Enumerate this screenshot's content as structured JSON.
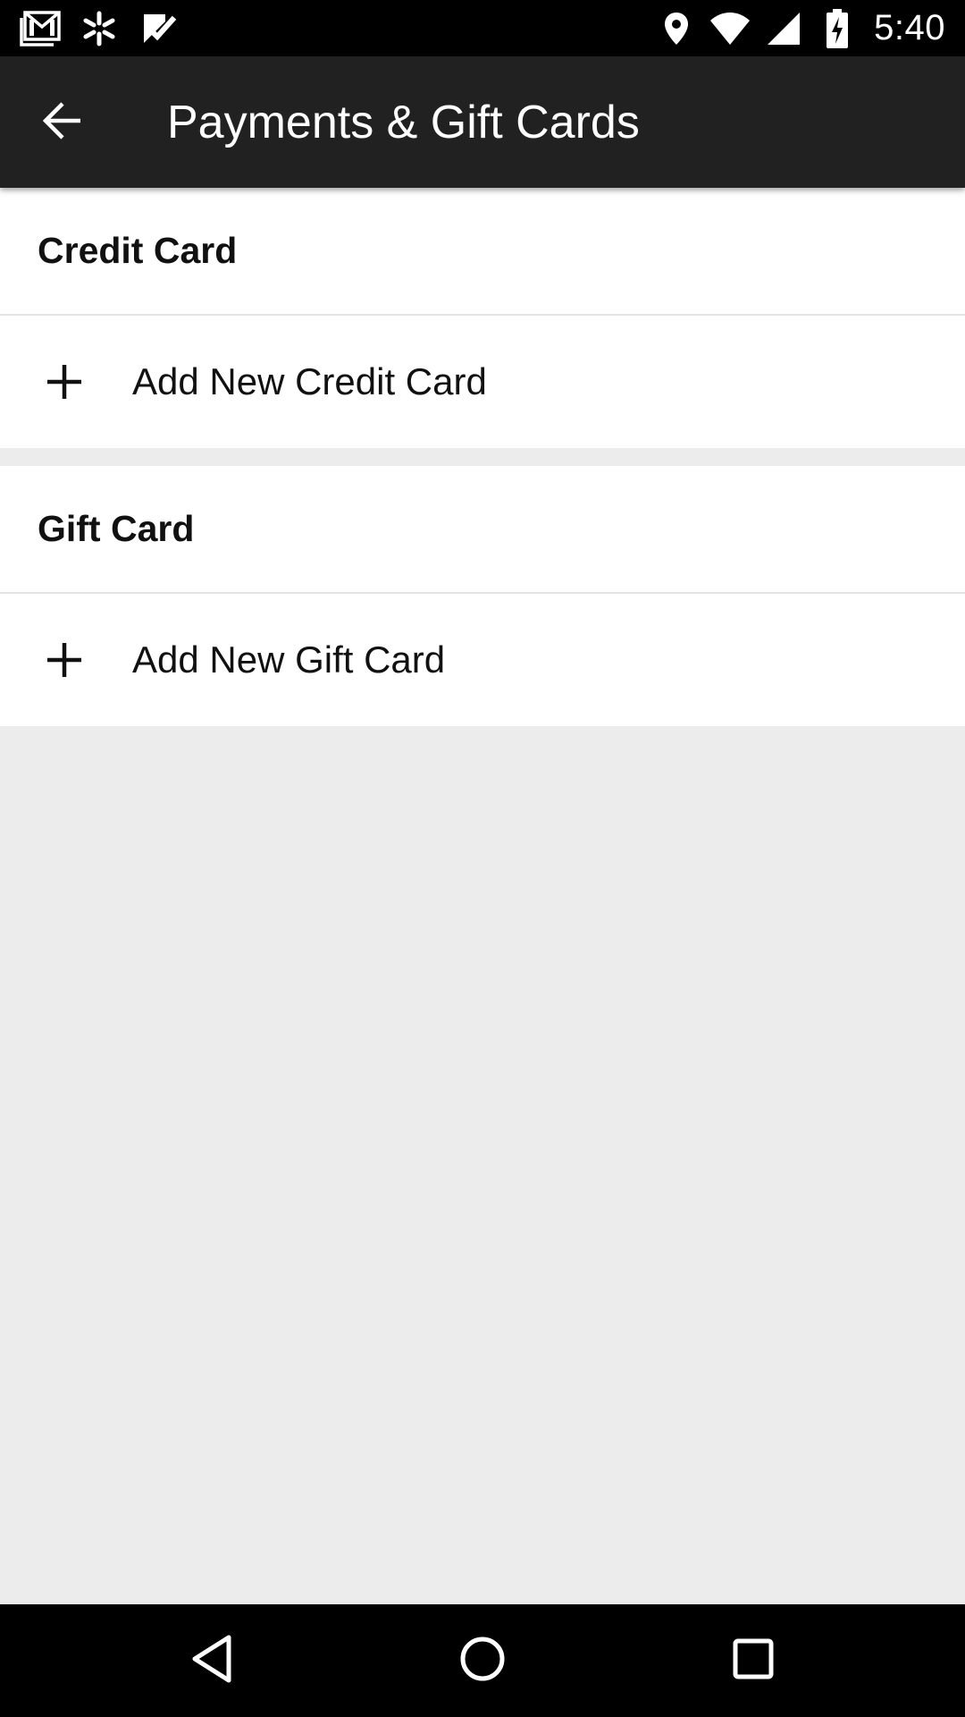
{
  "status_bar": {
    "time": "5:40",
    "left_icons": [
      "gmail-icon",
      "walmart-spark-icon",
      "task-check-icon"
    ],
    "right_icons": [
      "location-icon",
      "wifi-icon",
      "cell-signal-icon",
      "battery-charging-icon"
    ]
  },
  "app_bar": {
    "title": "Payments & Gift Cards",
    "back_icon": "arrow-back-icon",
    "background": "#212121"
  },
  "sections": [
    {
      "header": "Credit Card",
      "add_label": "Add New Credit Card",
      "add_icon": "plus-icon"
    },
    {
      "header": "Gift Card",
      "add_label": "Add New Gift Card",
      "add_icon": "plus-icon"
    }
  ],
  "nav_bar": {
    "buttons": [
      "nav-back-icon",
      "nav-home-icon",
      "nav-recents-icon"
    ]
  },
  "colors": {
    "page_background": "#ececec",
    "section_background": "#ffffff",
    "text": "#111111"
  }
}
